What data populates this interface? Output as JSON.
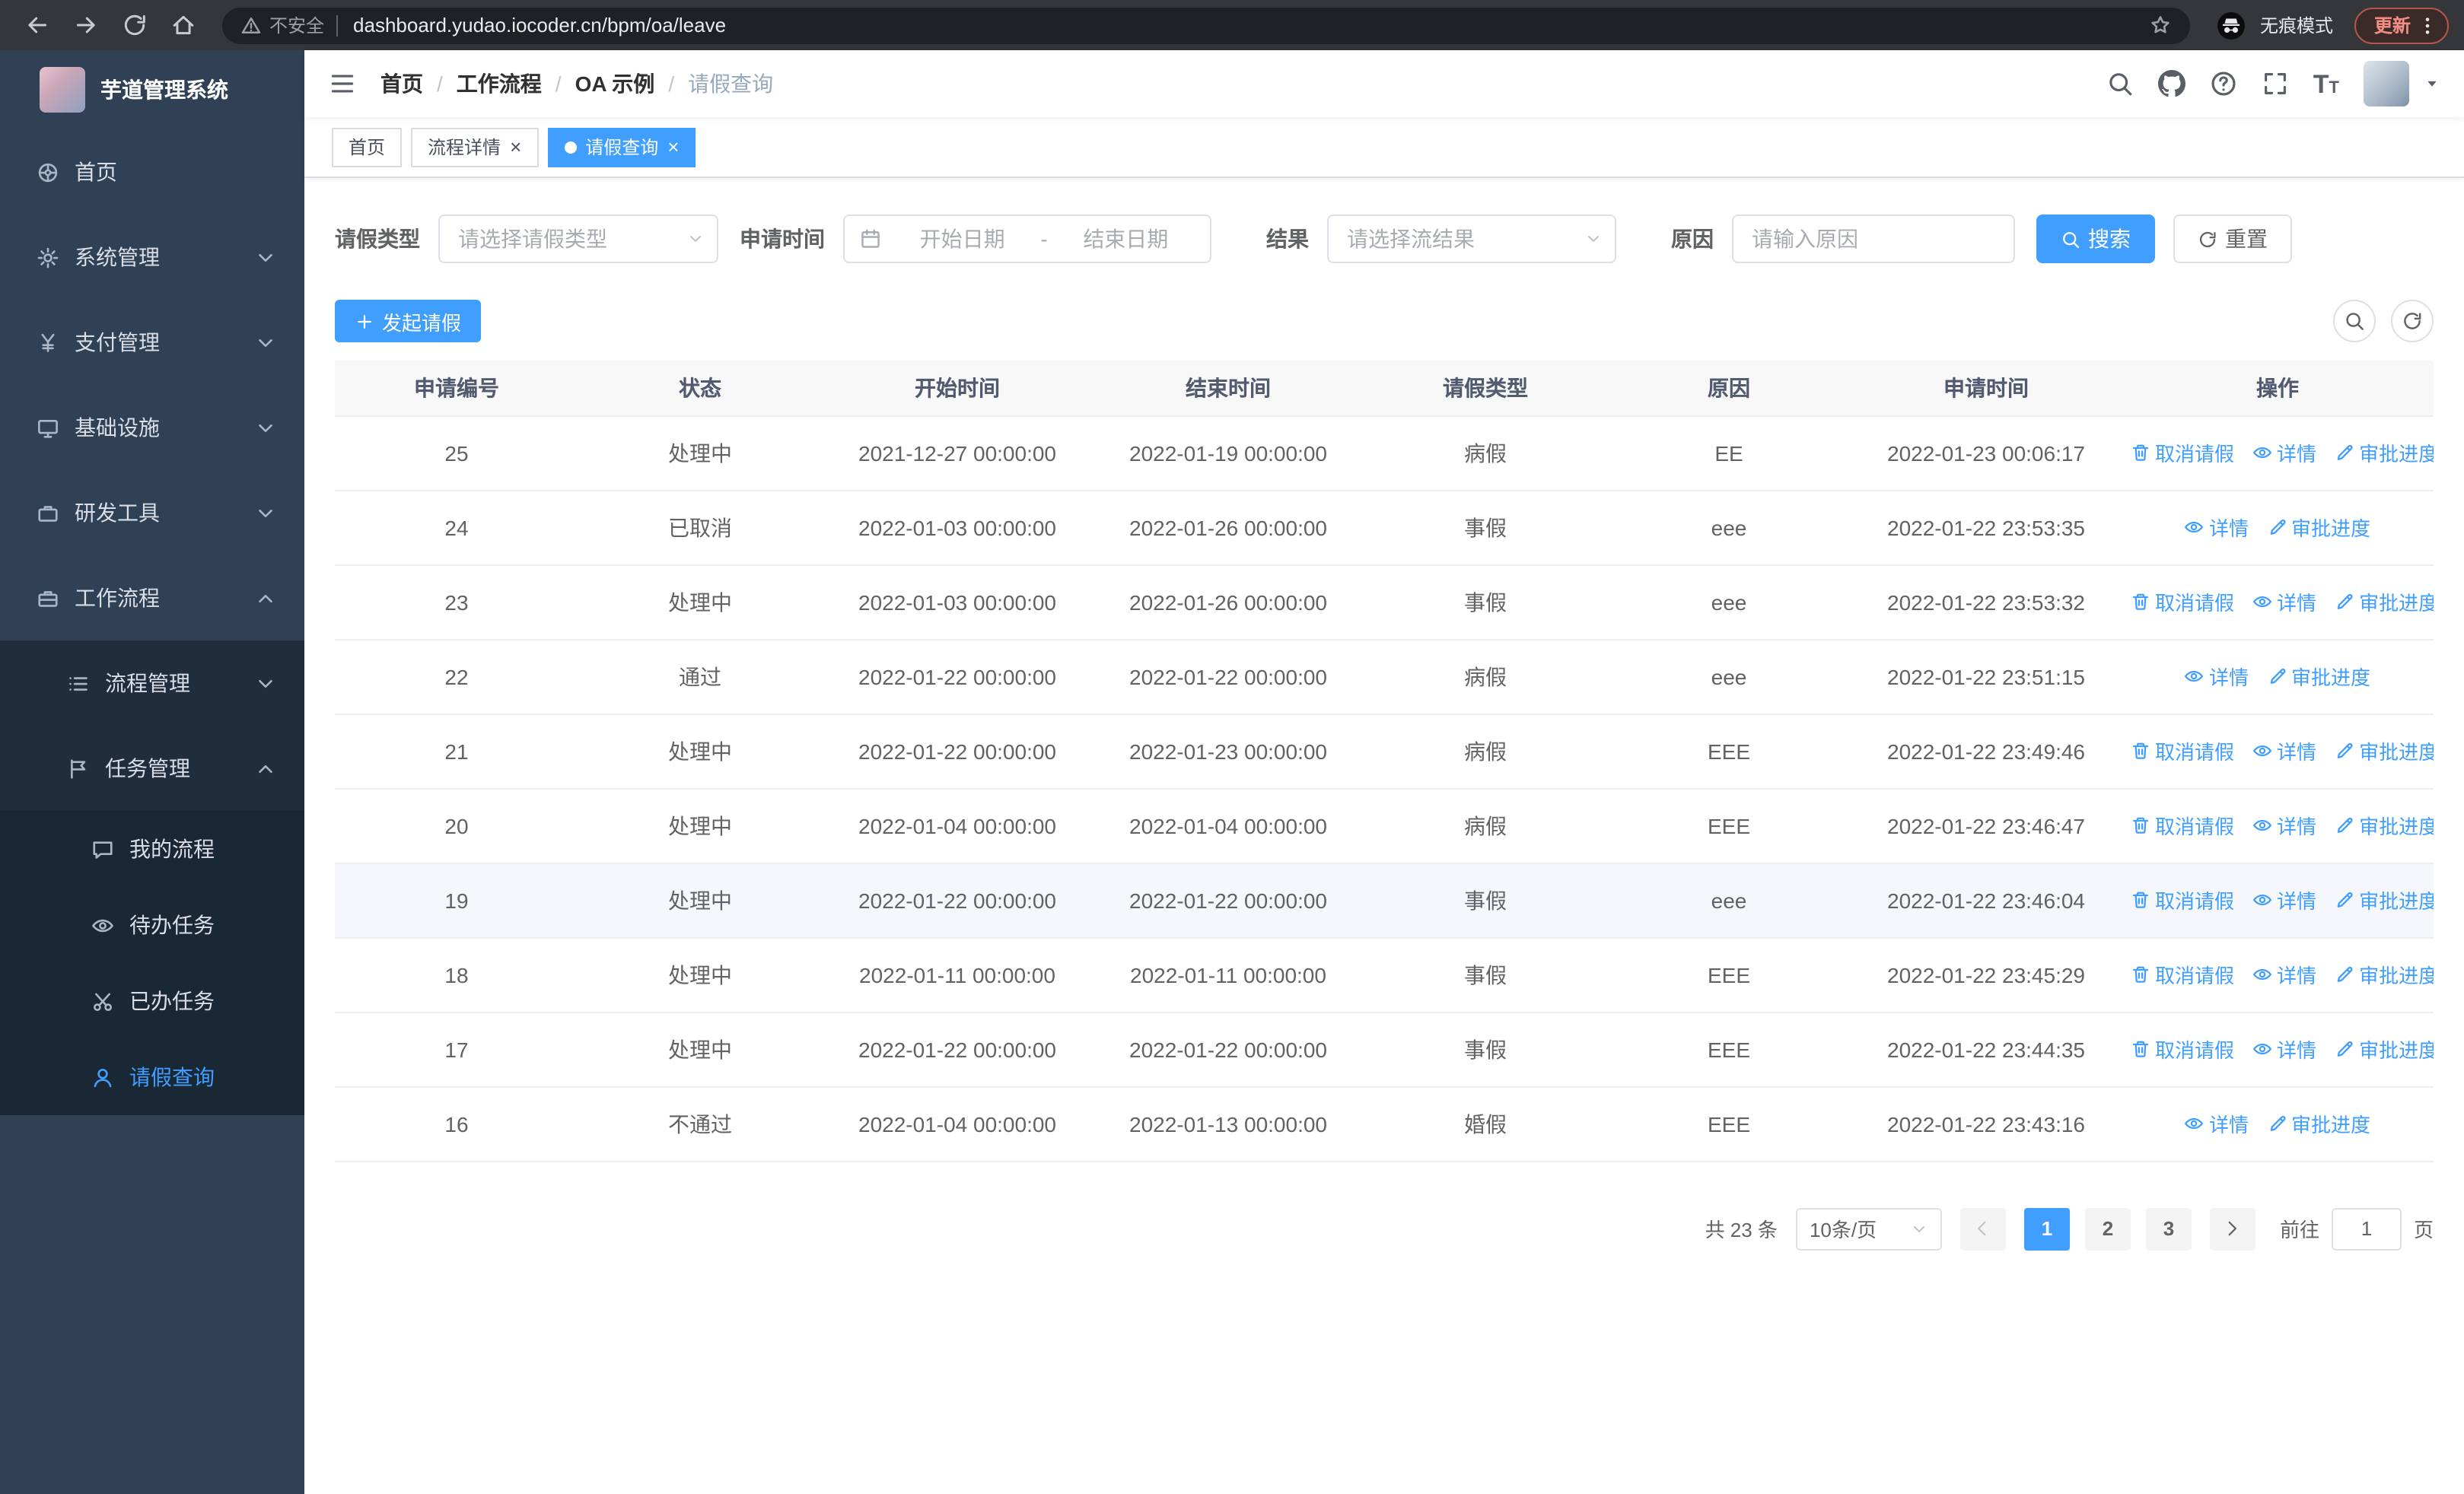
{
  "colors": {
    "accent": "#409eff",
    "sidebar_bg": "#304156",
    "submenu_bg": "#1f2d3d",
    "active_tab_bg": "#409eff"
  },
  "browser": {
    "security_label": "不安全",
    "url": "dashboard.yudao.iocoder.cn/bpm/oa/leave",
    "incognito_label": "无痕模式",
    "update_label": "更新"
  },
  "sidebar": {
    "title": "芋道管理系统",
    "menu": [
      {
        "name": "home",
        "label": "首页",
        "icon": "dashboard-icon",
        "chevron": "none",
        "level": 1,
        "active": false
      },
      {
        "name": "system",
        "label": "系统管理",
        "icon": "gear-icon",
        "chevron": "down",
        "level": 1,
        "active": false
      },
      {
        "name": "payment",
        "label": "支付管理",
        "icon": "pay-icon",
        "chevron": "down",
        "level": 1,
        "active": false
      },
      {
        "name": "infrastructure",
        "label": "基础设施",
        "icon": "monitor-icon",
        "chevron": "down",
        "level": 1,
        "active": false
      },
      {
        "name": "devtools",
        "label": "研发工具",
        "icon": "toolbox-icon",
        "chevron": "down",
        "level": 1,
        "active": false
      },
      {
        "name": "workflow",
        "label": "工作流程",
        "icon": "briefcase-icon",
        "chevron": "up",
        "level": 1,
        "active": false
      },
      {
        "name": "process-management",
        "label": "流程管理",
        "icon": "list-icon",
        "chevron": "down",
        "level": 2,
        "active": false
      },
      {
        "name": "task-management",
        "label": "任务管理",
        "icon": "flag-icon",
        "chevron": "up",
        "level": 2,
        "active": false
      },
      {
        "name": "my-process",
        "label": "我的流程",
        "icon": "chat-icon",
        "chevron": "none",
        "level": 3,
        "active": false
      },
      {
        "name": "todo-tasks",
        "label": "待办任务",
        "icon": "eye-icon",
        "chevron": "none",
        "level": 3,
        "active": false
      },
      {
        "name": "done-tasks",
        "label": "已办任务",
        "icon": "scissors-icon",
        "chevron": "none",
        "level": 3,
        "active": false
      },
      {
        "name": "leave-query",
        "label": "请假查询",
        "icon": "user-icon",
        "chevron": "none",
        "level": 3,
        "active": true
      }
    ]
  },
  "breadcrumb": [
    "首页",
    "工作流程",
    "OA 示例",
    "请假查询"
  ],
  "tabs": [
    {
      "name": "home",
      "label": "首页",
      "active": false,
      "closable": false
    },
    {
      "name": "process-detail",
      "label": "流程详情",
      "active": false,
      "closable": true
    },
    {
      "name": "leave-query",
      "label": "请假查询",
      "active": true,
      "closable": true
    }
  ],
  "filters": {
    "leave_type_label": "请假类型",
    "leave_type_placeholder": "请选择请假类型",
    "apply_time_label": "申请时间",
    "start_date_placeholder": "开始日期",
    "date_separator": "-",
    "end_date_placeholder": "结束日期",
    "result_label": "结果",
    "result_placeholder": "请选择流结果",
    "reason_label": "原因",
    "reason_placeholder": "请输入原因",
    "search_button": "搜索",
    "reset_button": "重置"
  },
  "toolbar": {
    "create_label": "发起请假"
  },
  "table": {
    "columns": [
      "申请编号",
      "状态",
      "开始时间",
      "结束时间",
      "请假类型",
      "原因",
      "申请时间",
      "操作"
    ],
    "action_defs": {
      "cancel": {
        "label": "取消请假",
        "icon": "delete-icon",
        "name": "cancel-leave-action"
      },
      "detail": {
        "label": "详情",
        "icon": "view-icon",
        "name": "view-detail-action"
      },
      "progress": {
        "label": "审批进度",
        "icon": "edit-icon",
        "name": "approval-progress-action"
      }
    },
    "rows": [
      {
        "id": "25",
        "status": "处理中",
        "start": "2021-12-27 00:00:00",
        "end": "2022-01-19 00:00:00",
        "type": "病假",
        "reason": "EE",
        "applied": "2022-01-23 00:06:17",
        "actions": [
          "cancel",
          "detail",
          "progress"
        ],
        "highlighted": false
      },
      {
        "id": "24",
        "status": "已取消",
        "start": "2022-01-03 00:00:00",
        "end": "2022-01-26 00:00:00",
        "type": "事假",
        "reason": "eee",
        "applied": "2022-01-22 23:53:35",
        "actions": [
          "detail",
          "progress"
        ],
        "highlighted": false
      },
      {
        "id": "23",
        "status": "处理中",
        "start": "2022-01-03 00:00:00",
        "end": "2022-01-26 00:00:00",
        "type": "事假",
        "reason": "eee",
        "applied": "2022-01-22 23:53:32",
        "actions": [
          "cancel",
          "detail",
          "progress"
        ],
        "highlighted": false
      },
      {
        "id": "22",
        "status": "通过",
        "start": "2022-01-22 00:00:00",
        "end": "2022-01-22 00:00:00",
        "type": "病假",
        "reason": "eee",
        "applied": "2022-01-22 23:51:15",
        "actions": [
          "detail",
          "progress"
        ],
        "highlighted": false
      },
      {
        "id": "21",
        "status": "处理中",
        "start": "2022-01-22 00:00:00",
        "end": "2022-01-23 00:00:00",
        "type": "病假",
        "reason": "EEE",
        "applied": "2022-01-22 23:49:46",
        "actions": [
          "cancel",
          "detail",
          "progress"
        ],
        "highlighted": false
      },
      {
        "id": "20",
        "status": "处理中",
        "start": "2022-01-04 00:00:00",
        "end": "2022-01-04 00:00:00",
        "type": "病假",
        "reason": "EEE",
        "applied": "2022-01-22 23:46:47",
        "actions": [
          "cancel",
          "detail",
          "progress"
        ],
        "highlighted": false
      },
      {
        "id": "19",
        "status": "处理中",
        "start": "2022-01-22 00:00:00",
        "end": "2022-01-22 00:00:00",
        "type": "事假",
        "reason": "eee",
        "applied": "2022-01-22 23:46:04",
        "actions": [
          "cancel",
          "detail",
          "progress"
        ],
        "highlighted": true
      },
      {
        "id": "18",
        "status": "处理中",
        "start": "2022-01-11 00:00:00",
        "end": "2022-01-11 00:00:00",
        "type": "事假",
        "reason": "EEE",
        "applied": "2022-01-22 23:45:29",
        "actions": [
          "cancel",
          "detail",
          "progress"
        ],
        "highlighted": false
      },
      {
        "id": "17",
        "status": "处理中",
        "start": "2022-01-22 00:00:00",
        "end": "2022-01-22 00:00:00",
        "type": "事假",
        "reason": "EEE",
        "applied": "2022-01-22 23:44:35",
        "actions": [
          "cancel",
          "detail",
          "progress"
        ],
        "highlighted": false
      },
      {
        "id": "16",
        "status": "不通过",
        "start": "2022-01-04 00:00:00",
        "end": "2022-01-13 00:00:00",
        "type": "婚假",
        "reason": "EEE",
        "applied": "2022-01-22 23:43:16",
        "actions": [
          "detail",
          "progress"
        ],
        "highlighted": false
      }
    ]
  },
  "pagination": {
    "total_label": "共 23 条",
    "page_size_label": "10条/页",
    "pages": [
      "1",
      "2",
      "3"
    ],
    "active_page": "1",
    "goto_label": "前往",
    "goto_value": "1",
    "goto_unit": "页"
  }
}
